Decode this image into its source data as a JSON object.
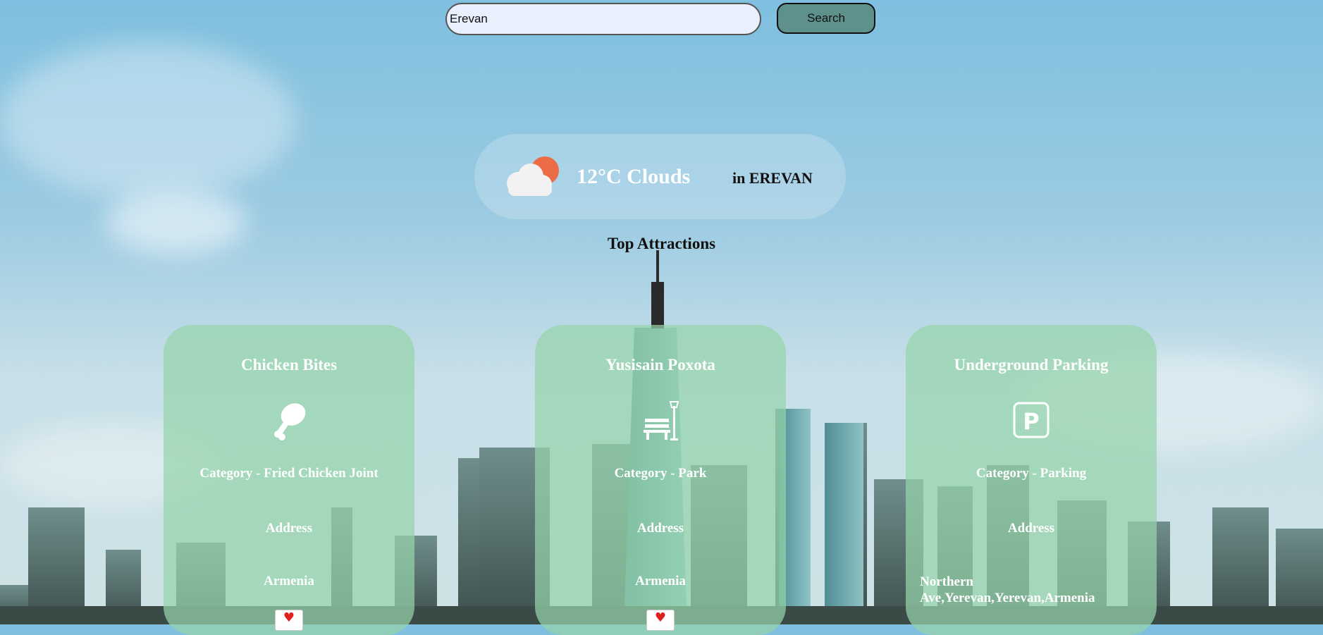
{
  "search": {
    "value": "Erevan",
    "button_label": "Search"
  },
  "weather": {
    "temp_text": "12°C Clouds",
    "location_text": "in EREVAN",
    "icon": "cloud-sun-icon"
  },
  "attractions": {
    "title": "Top Attractions",
    "cards": [
      {
        "name": "Chicken Bites",
        "icon": "drumstick-icon",
        "category": "Category - Fried Chicken Joint",
        "address_label": "Address",
        "address": "Armenia"
      },
      {
        "name": "Yusisain Poxota",
        "icon": "park-bench-icon",
        "category": "Category - Park",
        "address_label": "Address",
        "address": "Armenia"
      },
      {
        "name": "Underground Parking",
        "icon": "parking-icon",
        "category": "Category - Parking",
        "address_label": "Address",
        "address": "Northern Ave,Yerevan,Yerevan,Armenia"
      }
    ]
  },
  "colors": {
    "card_bg": "#96d4aa",
    "search_button": "#5e918b",
    "heart": "#e0201f"
  }
}
